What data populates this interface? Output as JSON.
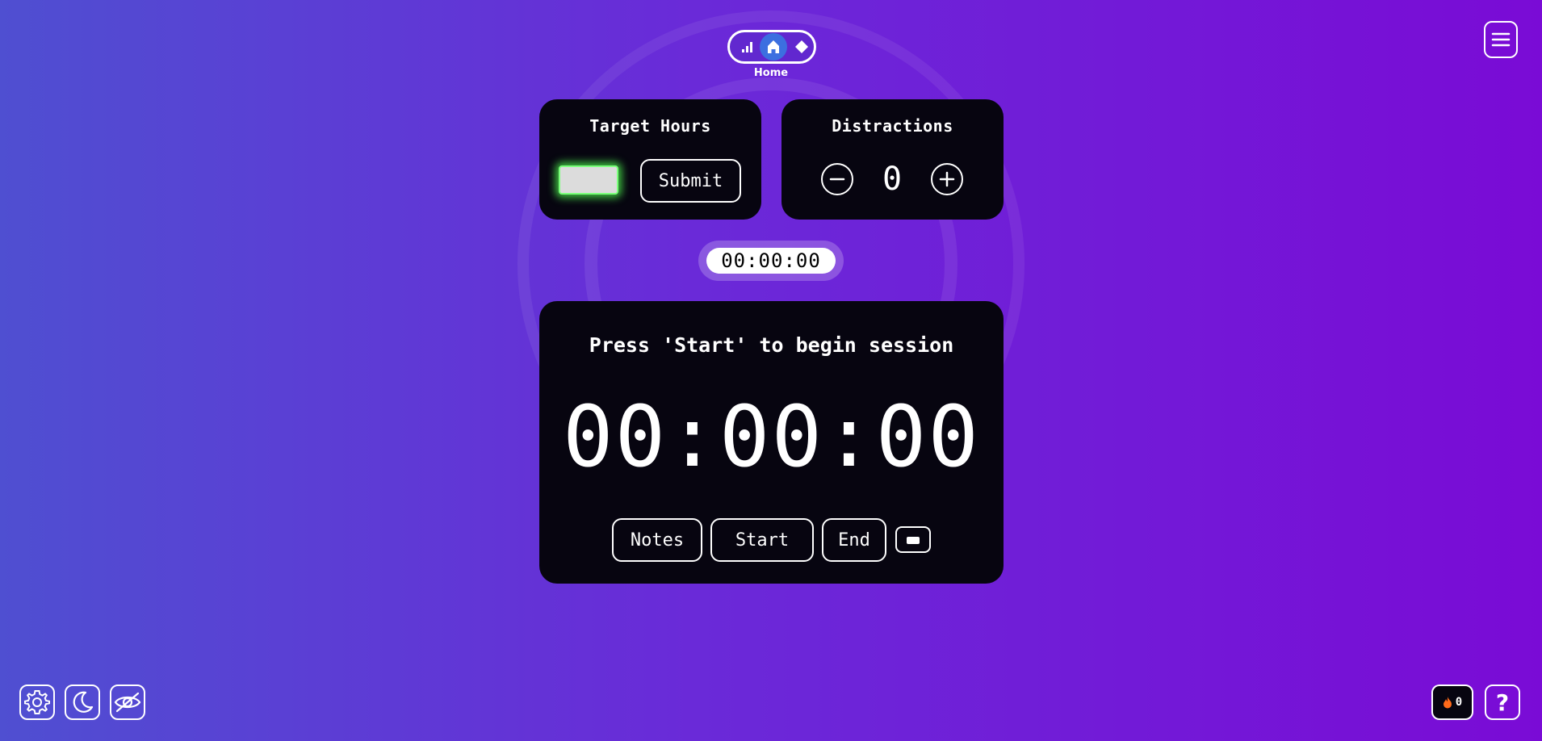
{
  "nav": {
    "label": "Home",
    "icons": [
      "signal-bars-icon",
      "home-icon",
      "diamond-icon"
    ],
    "active_color": "#3c6fe0"
  },
  "menu": {
    "icon": "hamburger-menu-icon"
  },
  "target_hours": {
    "title": "Target Hours",
    "input_value": "",
    "submit_label": "Submit",
    "glow_color": "#50ff50"
  },
  "distractions": {
    "title": "Distractions",
    "count": "0",
    "minus_icon": "minus-icon",
    "plus_icon": "plus-icon"
  },
  "mini_timer": {
    "value": "00:00:00"
  },
  "session": {
    "prompt": "Press 'Start' to begin session",
    "timer": "00:00:00",
    "notes_label": "Notes",
    "start_label": "Start",
    "end_label": "End",
    "mini_icon": "mini-player-icon"
  },
  "bottom_left": {
    "icons": [
      "gear-icon",
      "moon-icon",
      "eye-slash-icon"
    ]
  },
  "bottom_right": {
    "streak_count": "0",
    "streak_icon": "flame-icon",
    "help_label": "?"
  },
  "colors": {
    "background_start": "#4f4fd1",
    "background_end": "#7a0bd6",
    "card": "#070510",
    "flame": "#ff6a1a"
  }
}
